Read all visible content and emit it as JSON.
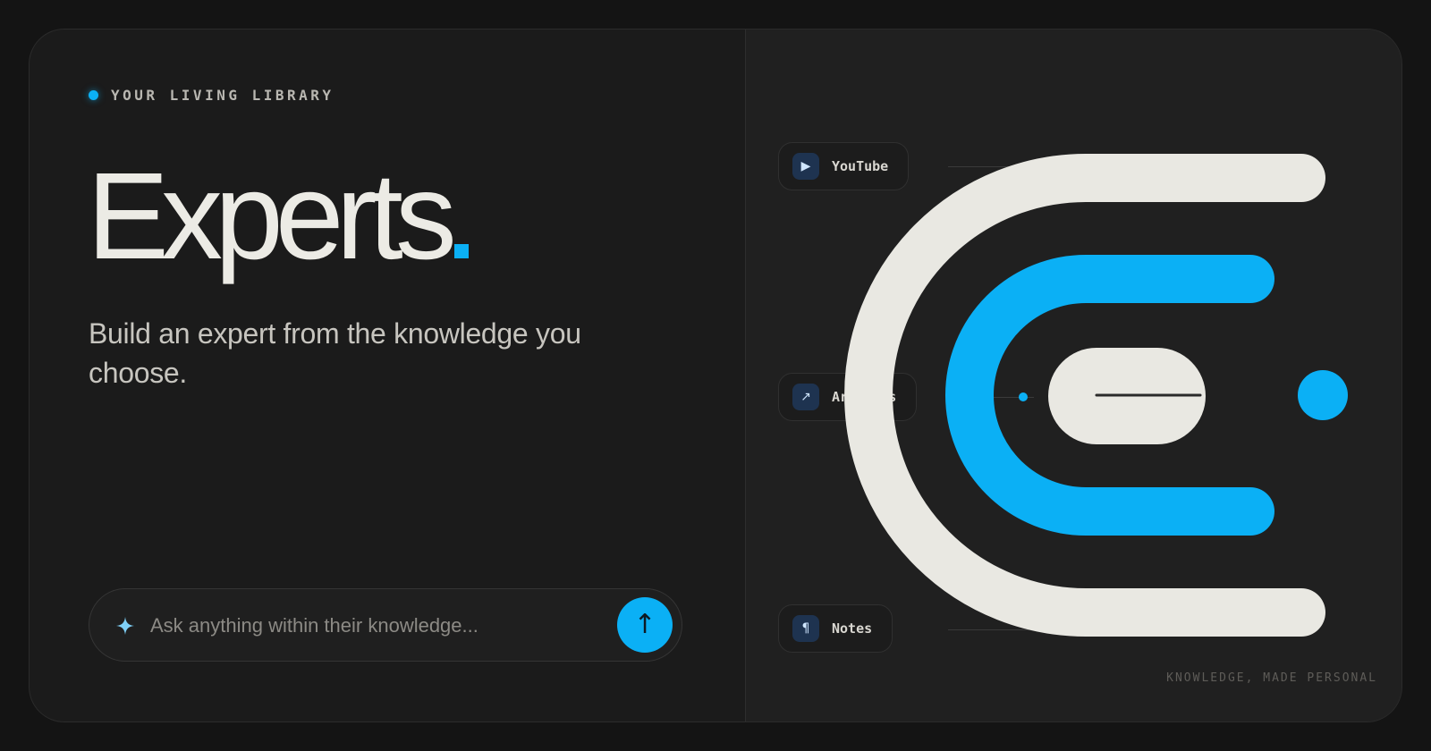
{
  "hero": {
    "eyebrow": "YOUR LIVING LIBRARY",
    "title": "Experts",
    "subtitle": "Build an expert from the knowledge you choose."
  },
  "search": {
    "placeholder": "Ask anything within their knowledge...",
    "send_icon": "↑"
  },
  "sources": {
    "items": [
      {
        "label": "YouTube",
        "icon": "play-icon",
        "glyph": "▶"
      },
      {
        "label": "Articles",
        "icon": "arrow-up-right-icon",
        "glyph": "↗"
      },
      {
        "label": "Notes",
        "icon": "pilcrow-icon",
        "glyph": "¶"
      }
    ]
  },
  "tagline": "KNOWLEDGE, MADE PERSONAL",
  "colors": {
    "accent": "#0bb0f5",
    "ink": "#ecebe5",
    "background": "#1b1b1b"
  }
}
